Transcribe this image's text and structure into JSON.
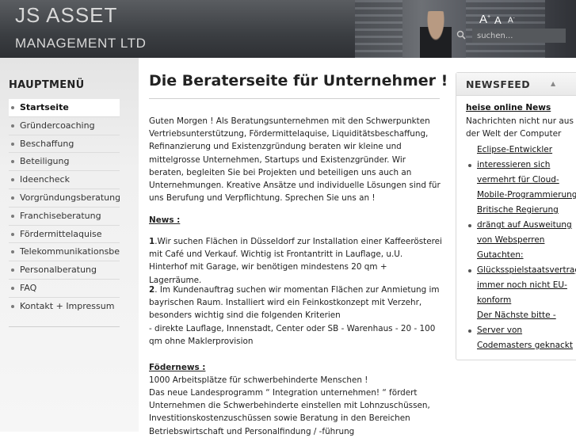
{
  "header": {
    "logo_line1": "JS ASSET",
    "logo_line2": "MANAGEMENT LTD",
    "font_large": "A",
    "font_normal": "A",
    "font_small": "A",
    "search_placeholder": "suchen..."
  },
  "nav": {
    "title": "HAUPTMENÜ",
    "items": [
      {
        "label": "Startseite"
      },
      {
        "label": "Gründercoaching"
      },
      {
        "label": "Beschaffung"
      },
      {
        "label": "Beteiligung"
      },
      {
        "label": "Ideencheck"
      },
      {
        "label": "Vorgründungsberatung"
      },
      {
        "label": "Franchiseberatung"
      },
      {
        "label": "Fördermittelaquise"
      },
      {
        "label": "Telekommunikationsberatung"
      },
      {
        "label": "Personalberatung"
      },
      {
        "label": "FAQ"
      },
      {
        "label": "Kontakt + Impressum"
      }
    ]
  },
  "main": {
    "title": "Die Beraterseite für Unternehmer !",
    "intro": "Guten Morgen ! Als Beratungsunternehmen mit den Schwerpunkten Vertriebsunterstützung, Fördermittelaquise, Liquiditätsbeschaffung, Refinanzierung und Existenzgründung  beraten wir kleine und mittelgrosse Unternehmen, Startups und Existenzgründer. Wir beraten, begleiten Sie bei Projekten und beteiligen uns auch an Unternehmungen. Kreative Ansätze und individuelle Lösungen sind für uns Berufung und Verpflichtung. Sprechen Sie uns an !",
    "news_heading": "News :",
    "news1_num": "1",
    "news1_text": ".Wir suchen Flächen in Düsseldorf zur Installation einer Kaffeerösterei mit Café und Verkauf. Wichtig ist Frontantritt in Lauflage,  u.U. Hinterhof mit Garage, wir benötigen mindestens 20 qm + Lagerräume.",
    "news2_num": "2",
    "news2_text": ". Im Kundenauftrag suchen wir momentan Flächen zur Anmietung im bayrischen Raum. Installiert wird ein Feinkostkonzept mit Verzehr, besonders wichtig sind die folgenden Kriterien",
    "news2_list": " - direkte Lauflage, Innenstadt, Center oder SB - Warenhaus - 20 - 100 qm ohne Maklerprovision",
    "foerder_heading": "Födernews :",
    "foerder_line1": "1000 Arbeitsplätze für schwerbehinderte Menschen !",
    "foerder_line2": "Das neue Landesprogramm “ Integration unternehmen! “ fördert Unternehmen die Schwerbehinderte einstellen mit Lohnzuschüssen, Investitionskostenzuschüssen sowie Beratung in den Bereichen Betriebswirtschaft und Personalfindung / -führung"
  },
  "newsfeed": {
    "title": "NEWSFEED",
    "toggle": "▲",
    "source_link": "heise online News",
    "source_desc": "Nachrichten nicht nur aus der Welt der Computer",
    "items": [
      {
        "lines": [
          "Eclipse-Entwickler",
          "interessieren sich",
          "vermehrt für Cloud-",
          "Mobile-Programmierung"
        ]
      },
      {
        "lines": [
          "Britische Regierung",
          "drängt auf Ausweitung",
          "von Websperren"
        ]
      },
      {
        "lines": [
          "Gutachten:",
          "Glücksspielstaatsvertrag",
          "immer noch nicht EU-",
          "konform"
        ]
      },
      {
        "lines": [
          "Der Nächste bitte -",
          "Server von",
          "Codemasters geknackt"
        ]
      }
    ]
  }
}
